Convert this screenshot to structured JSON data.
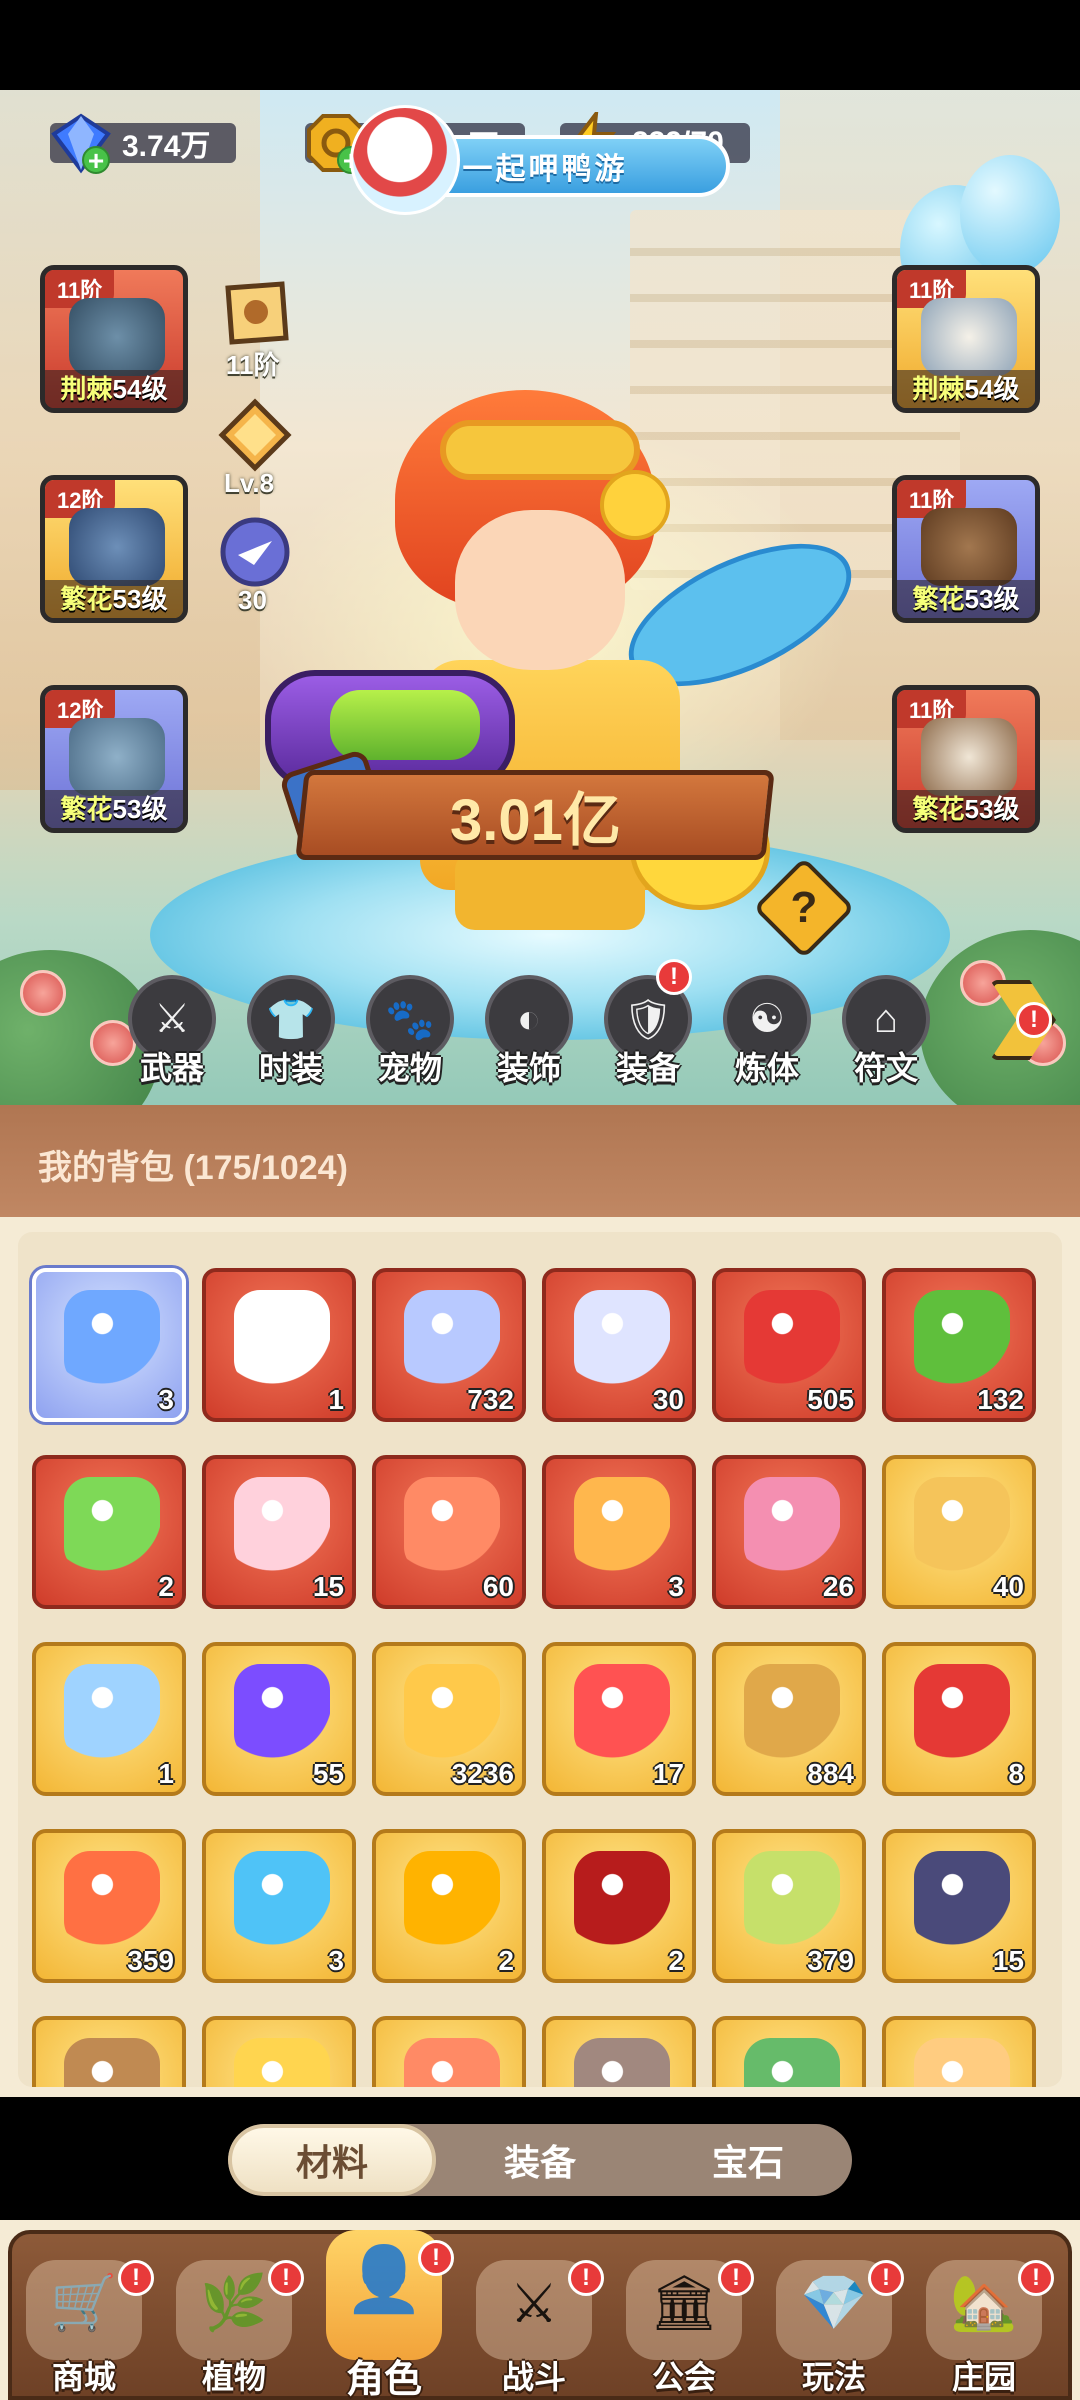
{
  "currencies": [
    {
      "name": "diamond",
      "value": "3.74万",
      "icon": "diamond-icon",
      "color": "#3f7bff"
    },
    {
      "name": "coin",
      "value": "326.85万",
      "icon": "coin-icon",
      "color": "#f0b020"
    },
    {
      "name": "energy",
      "value": "239/70",
      "icon": "lightning-icon",
      "color": "#ffcc22"
    }
  ],
  "event": {
    "label": "一起呷鸭游"
  },
  "equipment": {
    "left": [
      {
        "tier": "11阶",
        "set": "荆棘",
        "level": "54级",
        "item": "helmet"
      },
      {
        "tier": "12阶",
        "set": "繁花",
        "level": "53级",
        "item": "gloves"
      },
      {
        "tier": "12阶",
        "set": "繁花",
        "level": "53级",
        "item": "shorts"
      }
    ],
    "right": [
      {
        "tier": "11阶",
        "set": "荆棘",
        "level": "54级",
        "item": "armor"
      },
      {
        "tier": "11阶",
        "set": "繁花",
        "level": "53级",
        "item": "belt"
      },
      {
        "tier": "11阶",
        "set": "繁花",
        "level": "53级",
        "item": "boots"
      }
    ]
  },
  "badges": {
    "scroll_tier": "11阶",
    "rank_level": "Lv.8",
    "charm_count": "30"
  },
  "power": {
    "value": "3.01亿",
    "help": "?"
  },
  "role_tabs": [
    {
      "label": "武器",
      "icon": "weapon-icon",
      "notify": false
    },
    {
      "label": "时装",
      "icon": "costume-icon",
      "notify": false
    },
    {
      "label": "宠物",
      "icon": "pet-icon",
      "notify": false
    },
    {
      "label": "装饰",
      "icon": "mask-icon",
      "notify": false
    },
    {
      "label": "装备",
      "icon": "equipment-icon",
      "notify": true
    },
    {
      "label": "炼体",
      "icon": "body-training-icon",
      "notify": false
    },
    {
      "label": "符文",
      "icon": "rune-icon",
      "notify": false
    }
  ],
  "more_notify": "!",
  "backpack": {
    "title": "我的背包 (175/1024)",
    "items": [
      {
        "icon": "mask-icon",
        "qty": "3",
        "rarity": "blue"
      },
      {
        "icon": "shuriken-icon",
        "qty": "1",
        "rarity": "red"
      },
      {
        "icon": "star-crystal-icon",
        "qty": "732",
        "rarity": "red"
      },
      {
        "icon": "moon-star-icon",
        "qty": "30",
        "rarity": "red"
      },
      {
        "icon": "red-potion-icon",
        "qty": "505",
        "rarity": "red"
      },
      {
        "icon": "green-capsule-tube-icon",
        "qty": "132",
        "rarity": "red"
      },
      {
        "icon": "green-pill-icon",
        "qty": "2",
        "rarity": "red"
      },
      {
        "icon": "flower-crystal-icon",
        "qty": "15",
        "rarity": "red"
      },
      {
        "icon": "lotus-duo-icon",
        "qty": "60",
        "rarity": "red"
      },
      {
        "icon": "lotus-duo-icon",
        "qty": "3",
        "rarity": "red"
      },
      {
        "icon": "lotus-duo-icon",
        "qty": "26",
        "rarity": "red"
      },
      {
        "icon": "golden-flask-icon",
        "qty": "40",
        "rarity": "gold"
      },
      {
        "icon": "water-drop-icon",
        "qty": "1",
        "rarity": "gold"
      },
      {
        "icon": "skull-ticket-icon",
        "qty": "55",
        "rarity": "gold"
      },
      {
        "icon": "music-note-icon",
        "qty": "3236",
        "rarity": "gold"
      },
      {
        "icon": "ruby-key-icon",
        "qty": "17",
        "rarity": "gold"
      },
      {
        "icon": "golden-key-icon",
        "qty": "884",
        "rarity": "gold"
      },
      {
        "icon": "flame-scroll-icon",
        "qty": "8",
        "rarity": "gold"
      },
      {
        "icon": "fire-prism-icon",
        "qty": "359",
        "rarity": "gold"
      },
      {
        "icon": "mushroom-icon",
        "qty": "3",
        "rarity": "gold"
      },
      {
        "icon": "orbit-sphere-icon",
        "qty": "2",
        "rarity": "gold"
      },
      {
        "icon": "spell-book-icon",
        "qty": "2",
        "rarity": "gold"
      },
      {
        "icon": "golden-bud-icon",
        "qty": "379",
        "rarity": "gold"
      },
      {
        "icon": "rune-stone-icon",
        "qty": "15",
        "rarity": "gold"
      },
      {
        "icon": "flask-icon",
        "qty": "",
        "rarity": "gold"
      },
      {
        "icon": "gem-pile-icon",
        "qty": "",
        "rarity": "gold"
      },
      {
        "icon": "flower-icon",
        "qty": "",
        "rarity": "gold"
      },
      {
        "icon": "pot-icon",
        "qty": "",
        "rarity": "gold"
      },
      {
        "icon": "green-machine-icon",
        "qty": "",
        "rarity": "gold"
      },
      {
        "icon": "cake-icon",
        "qty": "",
        "rarity": "gold"
      }
    ]
  },
  "category_tabs": [
    {
      "label": "材料",
      "active": true
    },
    {
      "label": "装备",
      "active": false
    },
    {
      "label": "宝石",
      "active": false
    }
  ],
  "bottom_nav": [
    {
      "label": "商城",
      "icon": "shop-icon",
      "notify": true,
      "active": false
    },
    {
      "label": "植物",
      "icon": "plant-icon",
      "notify": true,
      "active": false
    },
    {
      "label": "角色",
      "icon": "character-icon",
      "notify": true,
      "active": true
    },
    {
      "label": "战斗",
      "icon": "battle-icon",
      "notify": true,
      "active": false
    },
    {
      "label": "公会",
      "icon": "guild-icon",
      "notify": true,
      "active": false
    },
    {
      "label": "玩法",
      "icon": "gameplay-icon",
      "notify": true,
      "active": false
    },
    {
      "label": "庄园",
      "icon": "manor-icon",
      "notify": true,
      "active": false
    }
  ],
  "colors": {
    "accent": "#f2a33a",
    "nav_bg": "#6e4126",
    "bag_header": "#b07652",
    "notify": "#e83a3a"
  }
}
